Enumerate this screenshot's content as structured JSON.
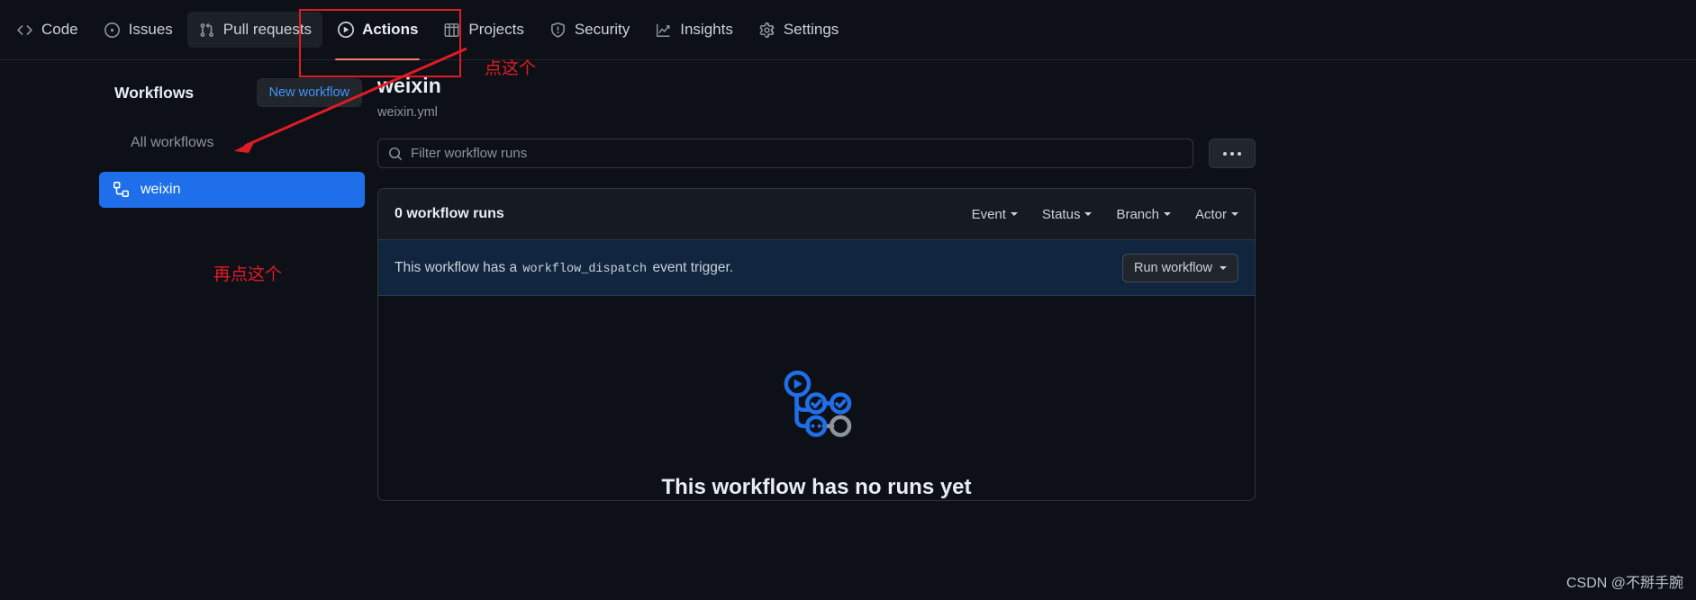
{
  "repo_nav": {
    "items": [
      {
        "label": "Code",
        "icon": "code-icon",
        "state": "default"
      },
      {
        "label": "Issues",
        "icon": "issue-icon",
        "state": "default"
      },
      {
        "label": "Pull requests",
        "icon": "pull-request-icon",
        "state": "hovered"
      },
      {
        "label": "Actions",
        "icon": "play-icon",
        "state": "selected"
      },
      {
        "label": "Projects",
        "icon": "table-icon",
        "state": "default"
      },
      {
        "label": "Security",
        "icon": "shield-icon",
        "state": "default"
      },
      {
        "label": "Insights",
        "icon": "graph-icon",
        "state": "default"
      },
      {
        "label": "Settings",
        "icon": "gear-icon",
        "state": "default"
      }
    ]
  },
  "sidebar": {
    "title": "Workflows",
    "new_workflow_label": "New workflow",
    "items": [
      {
        "label": "All workflows",
        "icon": "",
        "active": false
      },
      {
        "label": "weixin",
        "icon": "workflow-icon",
        "active": true
      }
    ]
  },
  "main": {
    "workflow_name": "weixin",
    "workflow_file": "weixin.yml",
    "filter_placeholder": "Filter workflow runs",
    "filter_value": "",
    "kebab_label": "...",
    "runs_count_label": "0 workflow runs",
    "run_filters": [
      "Event",
      "Status",
      "Branch",
      "Actor"
    ],
    "dispatch_prefix": "This workflow has a",
    "dispatch_code": "workflow_dispatch",
    "dispatch_suffix": "event trigger.",
    "run_workflow_label": "Run workflow",
    "empty_title": "This workflow has no runs yet"
  },
  "annotations": {
    "note_top": "点这个",
    "note_bottom": "再点这个",
    "color": "#e01b24"
  },
  "watermark": "CSDN @不掰手腕",
  "colors": {
    "background": "#0d1117",
    "panel": "#161b22",
    "border": "#30363d",
    "accent_blue": "#1f6feb",
    "link_blue": "#4493f8",
    "banner_bg": "#11253f",
    "selected_underline": "#f78166",
    "muted_text": "#8b949e"
  }
}
